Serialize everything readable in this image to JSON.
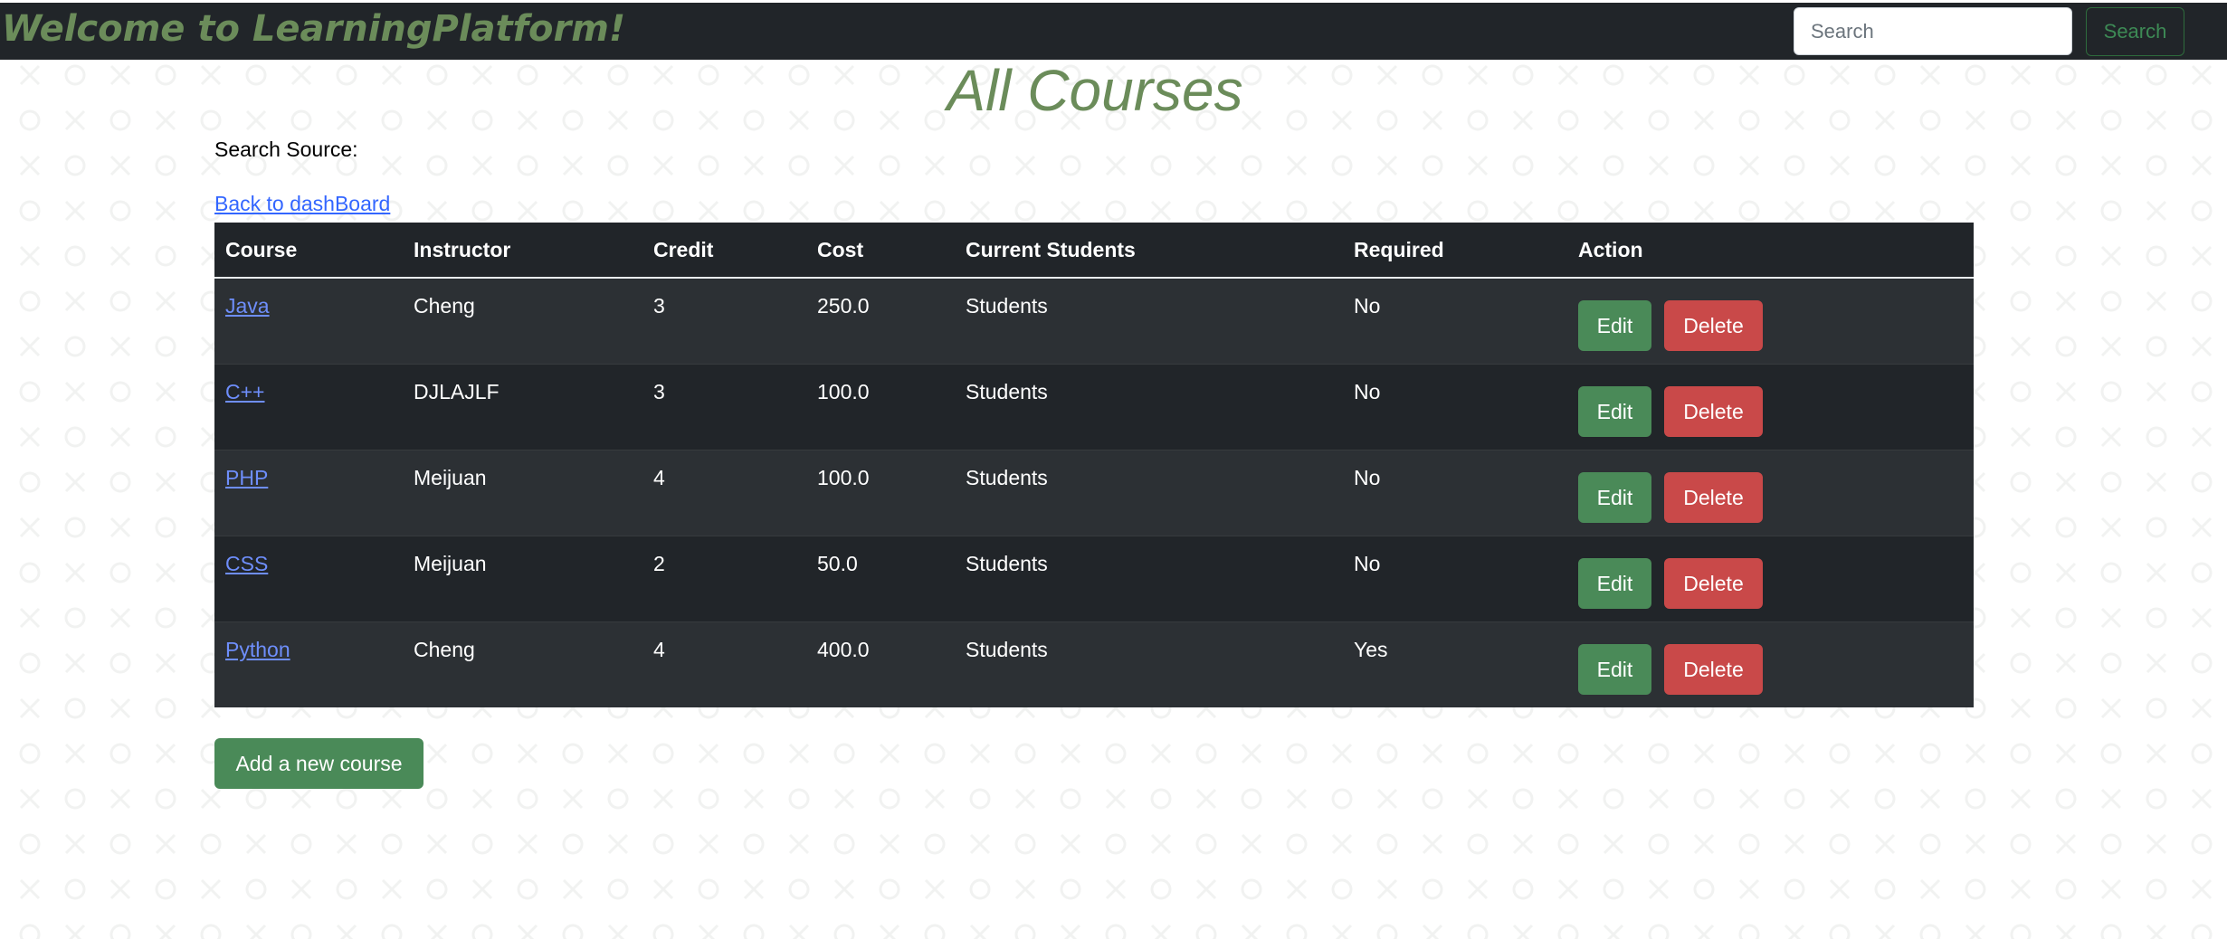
{
  "navbar": {
    "brand": "Welcome to LearningPlatform!",
    "search_placeholder": "Search",
    "search_button_label": "Search"
  },
  "page": {
    "title": "All Courses",
    "search_source_label": "Search Source:",
    "back_link_label": "Back to dashBoard",
    "add_course_label": "Add a new course"
  },
  "table": {
    "headers": [
      "Course",
      "Instructor",
      "Credit",
      "Cost",
      "Current Students",
      "Required",
      "Action"
    ],
    "rows": [
      {
        "course": "Java",
        "instructor": "Cheng",
        "credit": "3",
        "cost": "250.0",
        "students": "Students",
        "required": "No",
        "edit": "Edit",
        "delete": "Delete"
      },
      {
        "course": "C++",
        "instructor": "DJLAJLF",
        "credit": "3",
        "cost": "100.0",
        "students": "Students",
        "required": "No",
        "edit": "Edit",
        "delete": "Delete"
      },
      {
        "course": "PHP",
        "instructor": "Meijuan",
        "credit": "4",
        "cost": "100.0",
        "students": "Students",
        "required": "No",
        "edit": "Edit",
        "delete": "Delete"
      },
      {
        "course": "CSS",
        "instructor": "Meijuan",
        "credit": "2",
        "cost": "50.0",
        "students": "Students",
        "required": "No",
        "edit": "Edit",
        "delete": "Delete"
      },
      {
        "course": "Python",
        "instructor": "Cheng",
        "credit": "4",
        "cost": "400.0",
        "students": "Students",
        "required": "Yes",
        "edit": "Edit",
        "delete": "Delete"
      }
    ]
  },
  "colors": {
    "navbar_bg": "#212529",
    "brand_green": "#6b8c5a",
    "edit_green": "#4a8a58",
    "delete_red": "#c94949",
    "link_blue": "#6e8efb"
  }
}
